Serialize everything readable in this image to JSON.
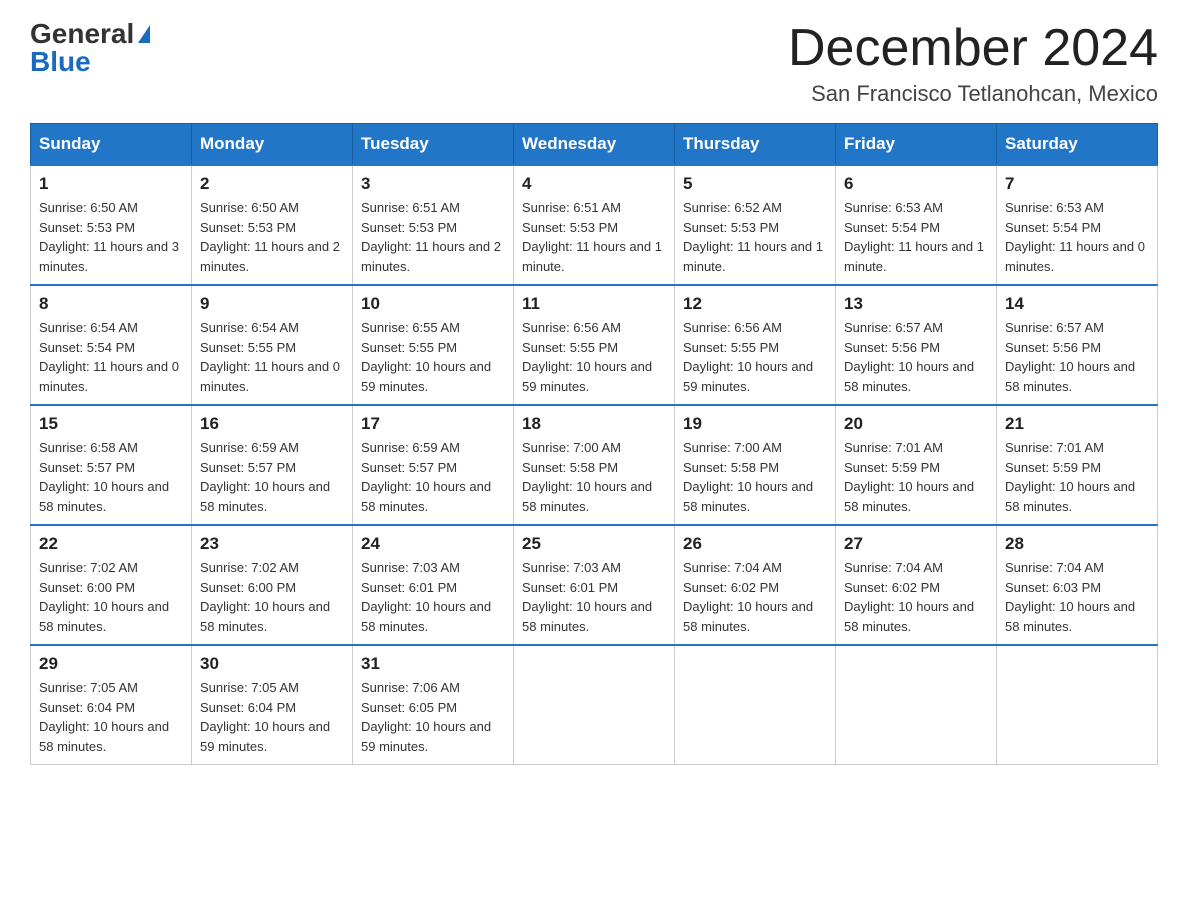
{
  "header": {
    "logo_general": "General",
    "logo_blue": "Blue",
    "month_year": "December 2024",
    "location": "San Francisco Tetlanohcan, Mexico"
  },
  "weekdays": [
    "Sunday",
    "Monday",
    "Tuesday",
    "Wednesday",
    "Thursday",
    "Friday",
    "Saturday"
  ],
  "weeks": [
    [
      {
        "day": "1",
        "sunrise": "6:50 AM",
        "sunset": "5:53 PM",
        "daylight": "11 hours and 3 minutes."
      },
      {
        "day": "2",
        "sunrise": "6:50 AM",
        "sunset": "5:53 PM",
        "daylight": "11 hours and 2 minutes."
      },
      {
        "day": "3",
        "sunrise": "6:51 AM",
        "sunset": "5:53 PM",
        "daylight": "11 hours and 2 minutes."
      },
      {
        "day": "4",
        "sunrise": "6:51 AM",
        "sunset": "5:53 PM",
        "daylight": "11 hours and 1 minute."
      },
      {
        "day": "5",
        "sunrise": "6:52 AM",
        "sunset": "5:53 PM",
        "daylight": "11 hours and 1 minute."
      },
      {
        "day": "6",
        "sunrise": "6:53 AM",
        "sunset": "5:54 PM",
        "daylight": "11 hours and 1 minute."
      },
      {
        "day": "7",
        "sunrise": "6:53 AM",
        "sunset": "5:54 PM",
        "daylight": "11 hours and 0 minutes."
      }
    ],
    [
      {
        "day": "8",
        "sunrise": "6:54 AM",
        "sunset": "5:54 PM",
        "daylight": "11 hours and 0 minutes."
      },
      {
        "day": "9",
        "sunrise": "6:54 AM",
        "sunset": "5:55 PM",
        "daylight": "11 hours and 0 minutes."
      },
      {
        "day": "10",
        "sunrise": "6:55 AM",
        "sunset": "5:55 PM",
        "daylight": "10 hours and 59 minutes."
      },
      {
        "day": "11",
        "sunrise": "6:56 AM",
        "sunset": "5:55 PM",
        "daylight": "10 hours and 59 minutes."
      },
      {
        "day": "12",
        "sunrise": "6:56 AM",
        "sunset": "5:55 PM",
        "daylight": "10 hours and 59 minutes."
      },
      {
        "day": "13",
        "sunrise": "6:57 AM",
        "sunset": "5:56 PM",
        "daylight": "10 hours and 58 minutes."
      },
      {
        "day": "14",
        "sunrise": "6:57 AM",
        "sunset": "5:56 PM",
        "daylight": "10 hours and 58 minutes."
      }
    ],
    [
      {
        "day": "15",
        "sunrise": "6:58 AM",
        "sunset": "5:57 PM",
        "daylight": "10 hours and 58 minutes."
      },
      {
        "day": "16",
        "sunrise": "6:59 AM",
        "sunset": "5:57 PM",
        "daylight": "10 hours and 58 minutes."
      },
      {
        "day": "17",
        "sunrise": "6:59 AM",
        "sunset": "5:57 PM",
        "daylight": "10 hours and 58 minutes."
      },
      {
        "day": "18",
        "sunrise": "7:00 AM",
        "sunset": "5:58 PM",
        "daylight": "10 hours and 58 minutes."
      },
      {
        "day": "19",
        "sunrise": "7:00 AM",
        "sunset": "5:58 PM",
        "daylight": "10 hours and 58 minutes."
      },
      {
        "day": "20",
        "sunrise": "7:01 AM",
        "sunset": "5:59 PM",
        "daylight": "10 hours and 58 minutes."
      },
      {
        "day": "21",
        "sunrise": "7:01 AM",
        "sunset": "5:59 PM",
        "daylight": "10 hours and 58 minutes."
      }
    ],
    [
      {
        "day": "22",
        "sunrise": "7:02 AM",
        "sunset": "6:00 PM",
        "daylight": "10 hours and 58 minutes."
      },
      {
        "day": "23",
        "sunrise": "7:02 AM",
        "sunset": "6:00 PM",
        "daylight": "10 hours and 58 minutes."
      },
      {
        "day": "24",
        "sunrise": "7:03 AM",
        "sunset": "6:01 PM",
        "daylight": "10 hours and 58 minutes."
      },
      {
        "day": "25",
        "sunrise": "7:03 AM",
        "sunset": "6:01 PM",
        "daylight": "10 hours and 58 minutes."
      },
      {
        "day": "26",
        "sunrise": "7:04 AM",
        "sunset": "6:02 PM",
        "daylight": "10 hours and 58 minutes."
      },
      {
        "day": "27",
        "sunrise": "7:04 AM",
        "sunset": "6:02 PM",
        "daylight": "10 hours and 58 minutes."
      },
      {
        "day": "28",
        "sunrise": "7:04 AM",
        "sunset": "6:03 PM",
        "daylight": "10 hours and 58 minutes."
      }
    ],
    [
      {
        "day": "29",
        "sunrise": "7:05 AM",
        "sunset": "6:04 PM",
        "daylight": "10 hours and 58 minutes."
      },
      {
        "day": "30",
        "sunrise": "7:05 AM",
        "sunset": "6:04 PM",
        "daylight": "10 hours and 59 minutes."
      },
      {
        "day": "31",
        "sunrise": "7:06 AM",
        "sunset": "6:05 PM",
        "daylight": "10 hours and 59 minutes."
      },
      null,
      null,
      null,
      null
    ]
  ]
}
